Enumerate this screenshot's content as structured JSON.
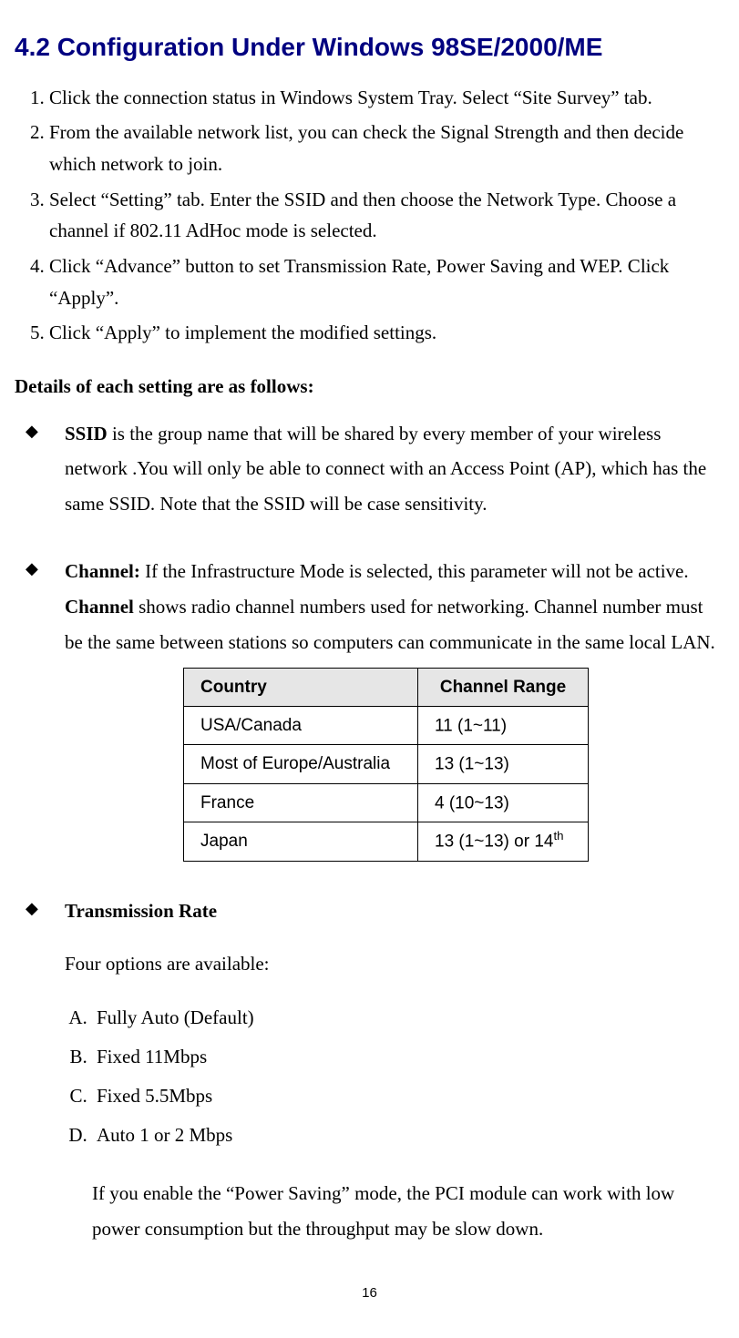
{
  "heading": "4.2    Configuration Under Windows 98SE/2000/ME",
  "steps": [
    "Click the connection status in Windows System Tray. Select “Site Survey” tab.",
    "From the available network list, you can check the Signal Strength and then decide which network to join.",
    "Select “Setting” tab.  Enter the SSID and then choose the Network Type. Choose a channel if 802.11 AdHoc mode is selected.",
    "Click “Advance” button to set Transmission Rate, Power Saving and WEP. Click “Apply”.",
    "Click “Apply” to implement the modified settings."
  ],
  "details_heading": "Details of each setting are as follows:",
  "ssid": {
    "label": "SSID",
    "text": " is the group name that will be shared by every member of your wireless network .You will only be able to connect with an Access Point (AP), which has the same SSID. Note that the SSID will be case sensitivity."
  },
  "channel": {
    "label": "Channel:",
    "text1": " If the Infrastructure Mode is selected, this parameter will not be active. ",
    "bold2": "Channel",
    "text2": " shows radio channel numbers used for networking. Channel number must be the same between stations so computers can communicate in the same local LAN."
  },
  "table": {
    "headers": [
      "Country",
      "Channel Range"
    ],
    "rows": [
      {
        "country": "USA/Canada",
        "range": "11 (1~11)",
        "sup": ""
      },
      {
        "country": "Most of Europe/Australia",
        "range": "13 (1~13)",
        "sup": ""
      },
      {
        "country": "France",
        "range": "4 (10~13)",
        "sup": ""
      },
      {
        "country": "Japan",
        "range": "13 (1~13) or 14",
        "sup": "th"
      }
    ]
  },
  "tx": {
    "label": "Transmission Rate",
    "intro": "Four options are available:",
    "options": [
      "Fully Auto (Default)",
      "Fixed 11Mbps",
      "Fixed 5.5Mbps",
      "Auto 1 or 2 Mbps"
    ],
    "note": "If you enable the “Power Saving” mode, the PCI module can work with low power consumption but the throughput may be slow down."
  },
  "page_number": "16"
}
